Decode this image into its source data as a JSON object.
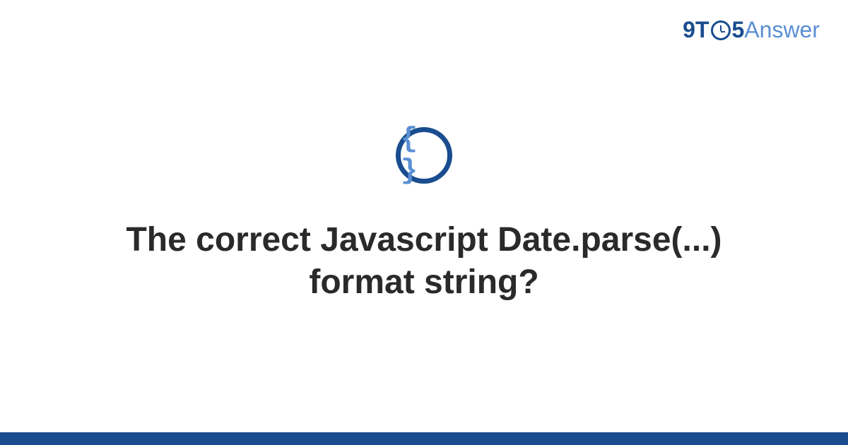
{
  "logo": {
    "part1": "9T",
    "part2": "5",
    "part3": "Answer"
  },
  "icon": {
    "glyph": "{ }"
  },
  "title": "The correct Javascript Date.parse(...) format string?"
}
